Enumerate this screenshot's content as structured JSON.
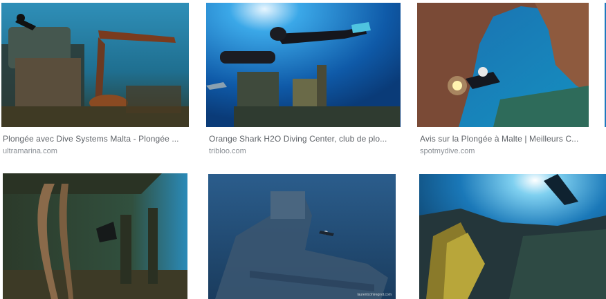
{
  "results": [
    {
      "title": "Plongée avec Dive Systems Malta - Plongée ...",
      "source": "ultramarina.com",
      "scene": "wreck-gun-diver"
    },
    {
      "title": "Orange Shark H2O Diving Center, club de plo...",
      "source": "tribloo.com",
      "scene": "diver-scooter-wreck"
    },
    {
      "title": "Avis sur la Plongée à Malte | Meilleurs C...",
      "source": "spotmydive.com",
      "scene": "cave-diver-torch"
    },
    {
      "title": "",
      "source": "",
      "scene": "wreck-interior-diver"
    },
    {
      "title": "",
      "source": "",
      "scene": "ship-wreck-blue",
      "watermark": "laurentcohiregnot.com"
    },
    {
      "title": "",
      "source": "",
      "scene": "reef-sunrays"
    }
  ]
}
